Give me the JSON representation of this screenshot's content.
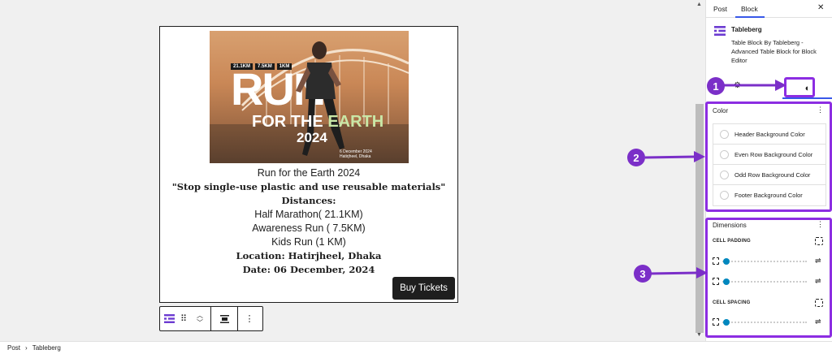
{
  "poster": {
    "chips": [
      "21.1KM",
      "7.5KM",
      "1KM"
    ],
    "run": "RUN",
    "for_the": "FOR THE ",
    "earth": "EARTH",
    "year": "2024",
    "info_line1": "6 December 2024",
    "info_line2": "Hatirjheel, Dhaka"
  },
  "content": {
    "lines": [
      {
        "text": "Run for the Earth 2024",
        "style": "sans"
      },
      {
        "text": "\"Stop single-use plastic and use reusable materials\"",
        "style": "serif"
      },
      {
        "text": "Distances:",
        "style": "serif"
      },
      {
        "text": "Half Marathon( 21.1KM)",
        "style": "sans"
      },
      {
        "text": "Awareness Run ( 7.5KM)",
        "style": "sans"
      },
      {
        "text": "Kids Run (1 KM)",
        "style": "sans"
      },
      {
        "text": "Location: Hatirjheel, Dhaka",
        "style": "serif"
      },
      {
        "text": "Date: 06 December, 2024",
        "style": "serif"
      }
    ],
    "buy_button": "Buy Tickets"
  },
  "sidebar": {
    "tab_post": "Post",
    "tab_block": "Block",
    "close": "✕",
    "block_name": "Tableberg",
    "block_desc": "Table Block By Tableberg - Advanced Table Block for Block Editor",
    "color_panel_title": "Color",
    "colors": [
      "Header Background Color",
      "Even Row Background Color",
      "Odd Row Background Color",
      "Footer Background Color"
    ],
    "dimensions_title": "Dimensions",
    "cell_padding": "CELL PADDING",
    "cell_spacing": "CELL SPACING"
  },
  "callouts": [
    "1",
    "2",
    "3"
  ],
  "footer": {
    "crumbs": [
      "Post",
      "Tableberg"
    ],
    "separator": "›"
  },
  "colors": {
    "accent": "#7b2fc8",
    "callout_border": "#8c2de2",
    "wp_blue": "#3858e9",
    "slider_blue": "#0087be",
    "button_dark": "#1e1e1e",
    "logo_purple": "#6c3bd1"
  }
}
